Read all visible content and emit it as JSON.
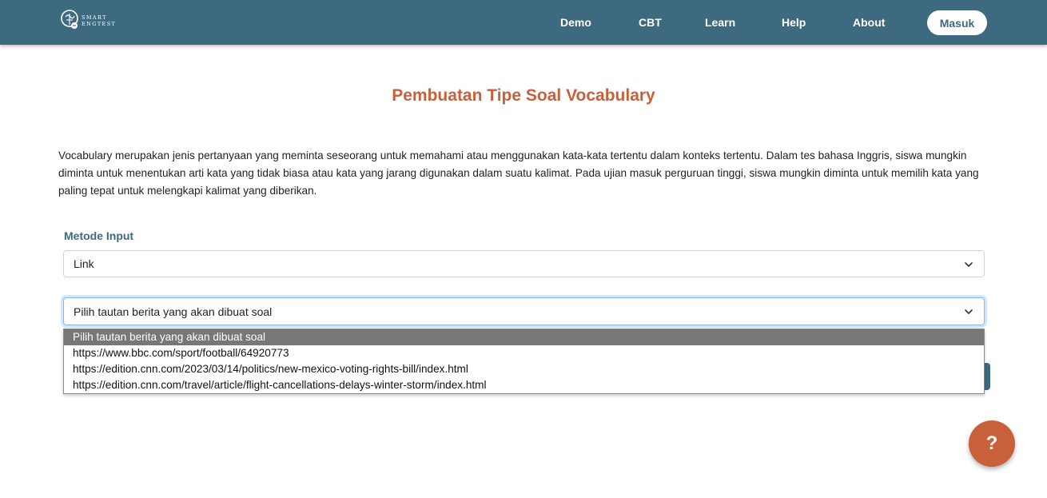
{
  "navbar": {
    "logo_text_line1": "SMART",
    "logo_text_line2": "ENGTEST",
    "links": [
      {
        "label": "Demo"
      },
      {
        "label": "CBT"
      },
      {
        "label": "Learn"
      },
      {
        "label": "Help"
      },
      {
        "label": "About"
      }
    ],
    "login_label": "Masuk",
    "background_color": "#3e6a80"
  },
  "main": {
    "title": "Pembuatan Tipe Soal Vocabulary",
    "description": "Vocabulary merupakan jenis pertanyaan yang meminta seseorang untuk memahami atau menggunakan kata-kata tertentu dalam konteks tertentu. Dalam tes bahasa Inggris, siswa mungkin diminta untuk menentukan arti kata yang tidak biasa atau kata yang jarang digunakan dalam suatu kalimat. Pada ujian masuk perguruan tinggi, siswa mungkin diminta untuk memilih kata yang paling tepat untuk melengkapi kalimat yang diberikan.",
    "input_method": {
      "label": "Metode Input",
      "selected": "Link"
    },
    "link_select": {
      "selected": "Pilih tautan berita yang akan dibuat soal",
      "options": [
        "Pilih tautan berita yang akan dibuat soal",
        "https://www.bbc.com/sport/football/64920773",
        "https://edition.cnn.com/2023/03/14/politics/new-mexico-voting-rights-bill/index.html",
        "https://edition.cnn.com/travel/article/flight-cancellations-delays-winter-storm/index.html"
      ]
    }
  },
  "help_button": {
    "label": "?",
    "color": "#c8603a"
  },
  "colors": {
    "title_accent": "#c8603a",
    "label_accent": "#3e6a80"
  }
}
